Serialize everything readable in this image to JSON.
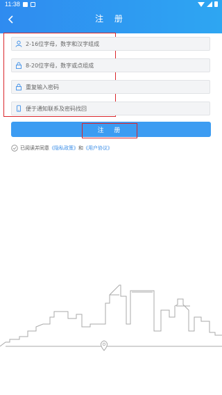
{
  "status_bar": {
    "time": "11:38"
  },
  "header": {
    "title": "注 册"
  },
  "form": {
    "username_placeholder": "2-16位字母，数字和汉字组成",
    "password_placeholder": "8-20位字母，数字或点组成",
    "confirm_placeholder": "重复输入密码",
    "phone_placeholder": "便于通知联系及密码找回",
    "submit_label": "注 册"
  },
  "agreement": {
    "prefix": "已阅读并同意",
    "privacy_link": "《隐私政策》",
    "and": "和",
    "user_link": "《用户协议》"
  },
  "colors": {
    "accent": "#3c9cf2",
    "highlight": "#d9252b"
  }
}
